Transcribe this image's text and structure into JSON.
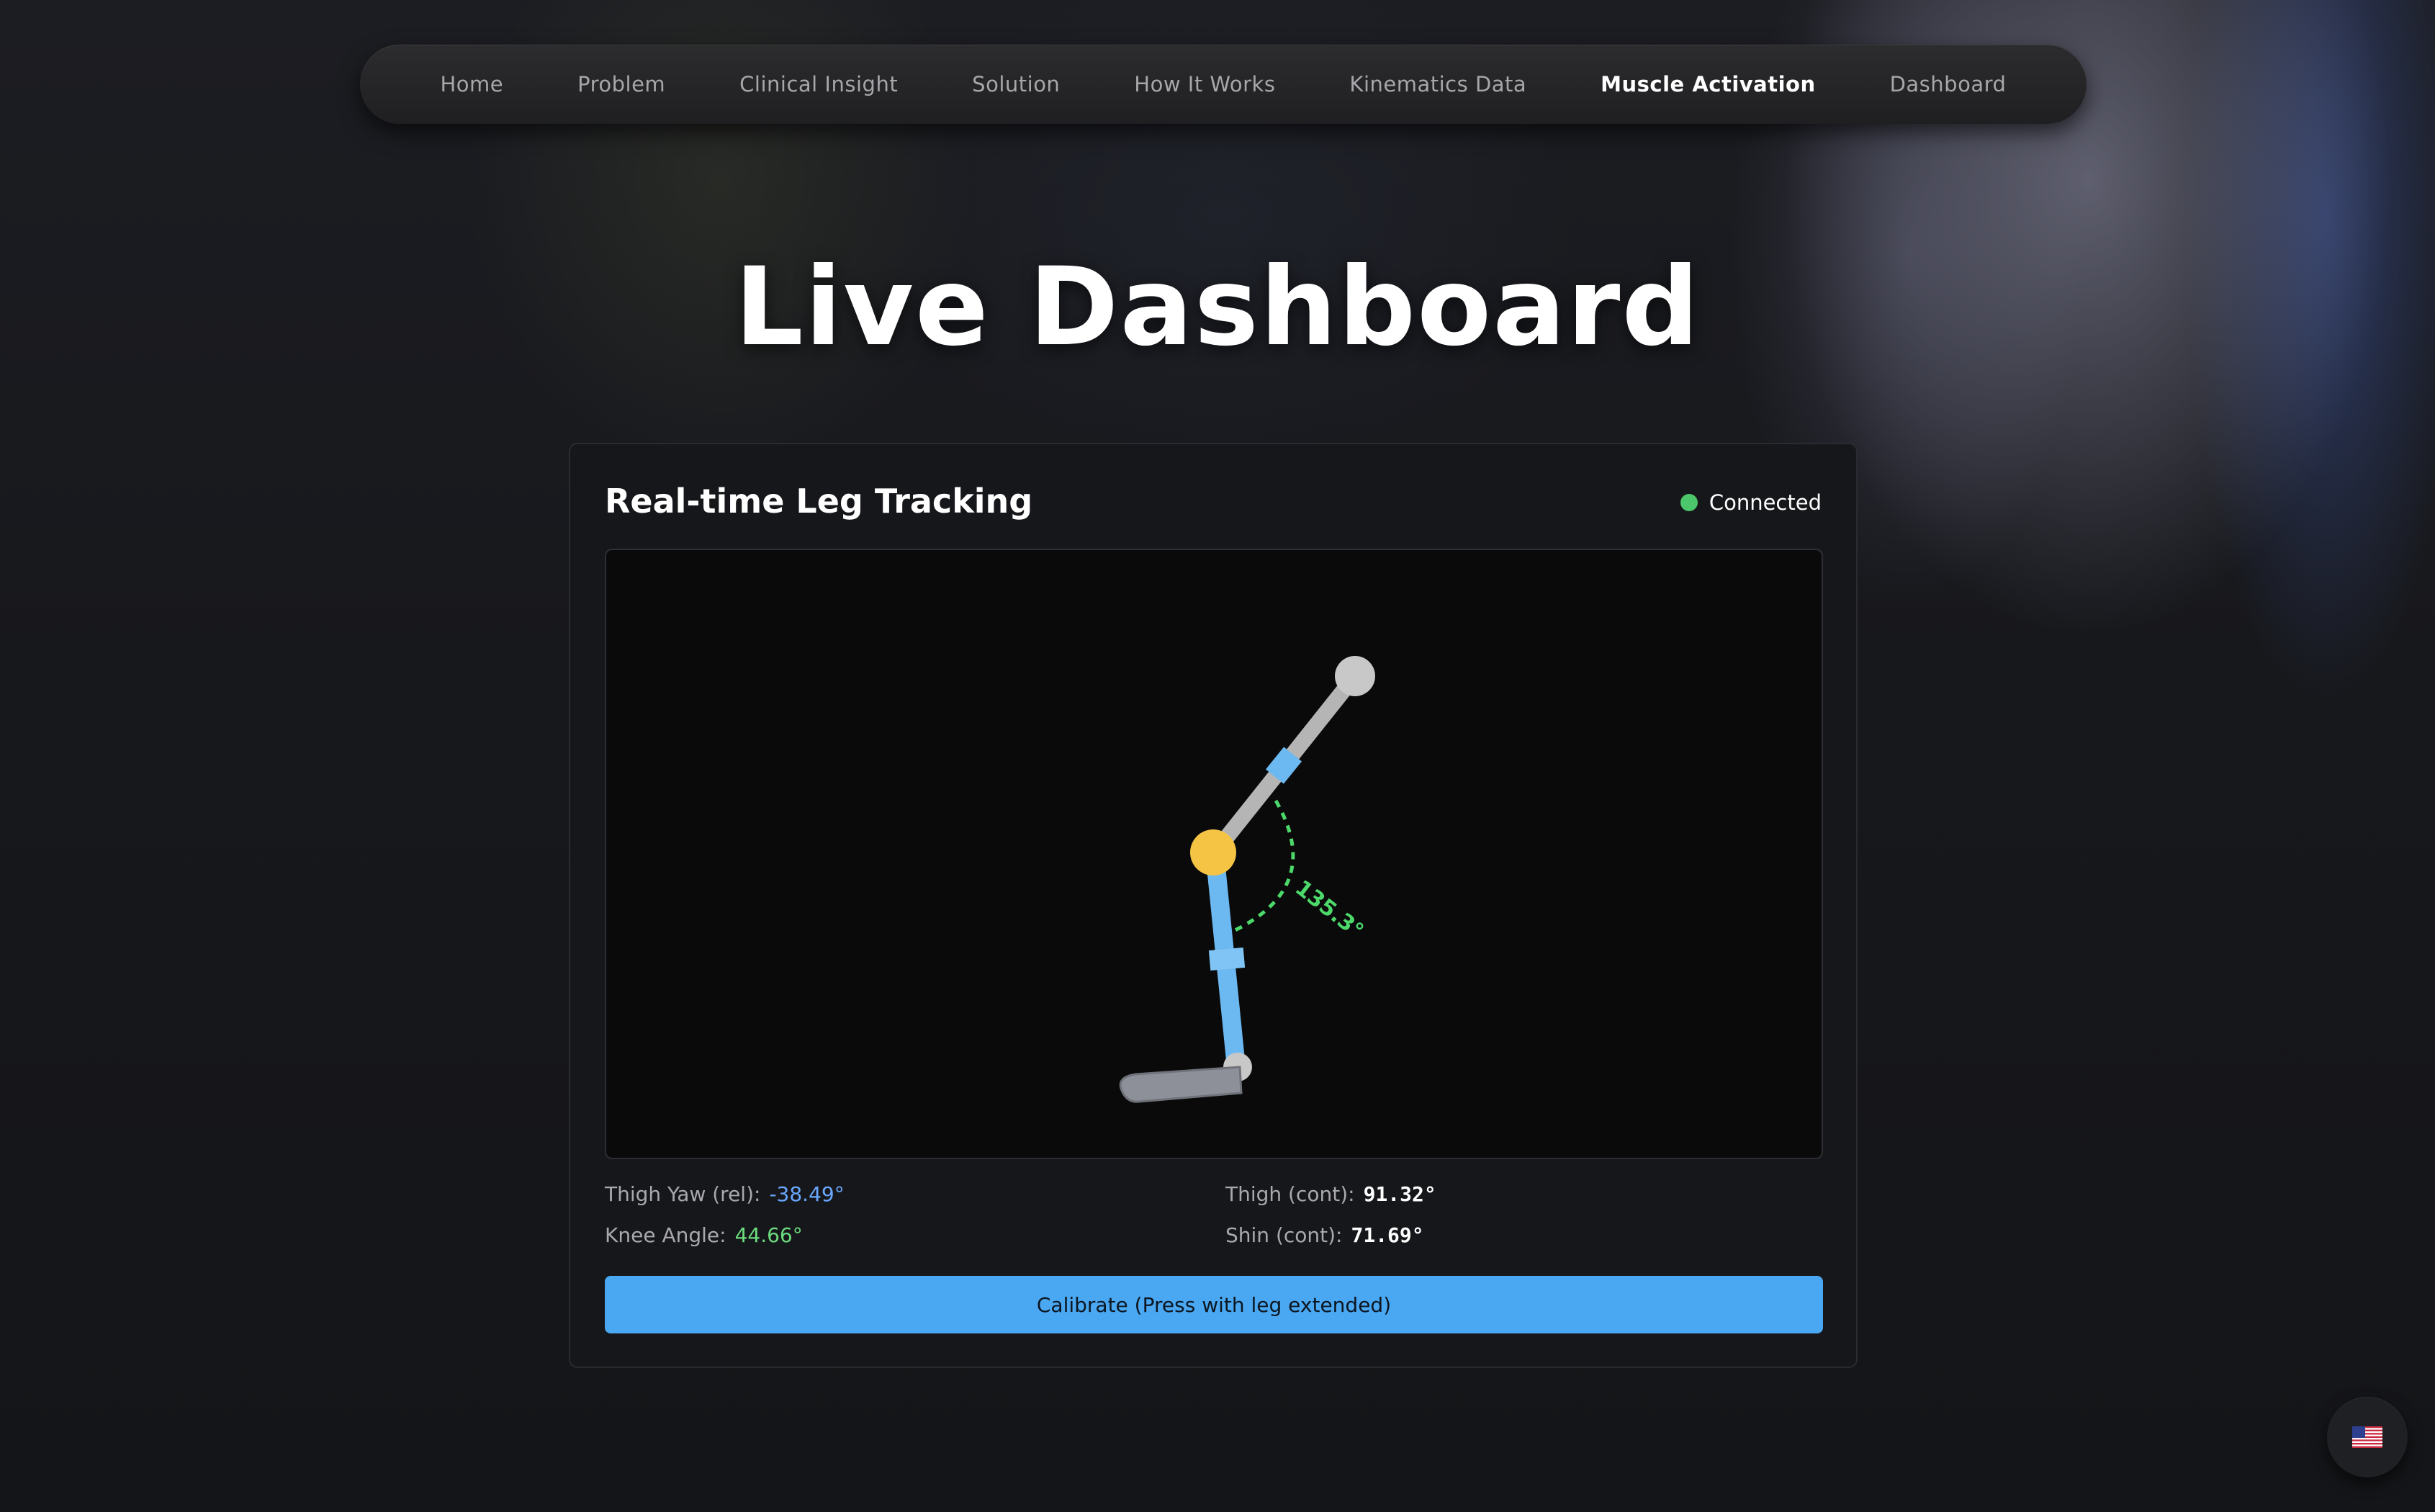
{
  "nav": {
    "items": [
      {
        "label": "Home"
      },
      {
        "label": "Problem"
      },
      {
        "label": "Clinical Insight"
      },
      {
        "label": "Solution"
      },
      {
        "label": "How It Works"
      },
      {
        "label": "Kinematics Data"
      },
      {
        "label": "Muscle Activation",
        "active": true
      },
      {
        "label": "Dashboard"
      }
    ]
  },
  "page": {
    "title": "Live Dashboard"
  },
  "card": {
    "title": "Real-time Leg Tracking",
    "status": "Connected",
    "status_color": "#4cc66a",
    "angle_label": "135.3°",
    "readings": {
      "thigh_yaw": {
        "label": "Thigh Yaw (rel):",
        "value": "-38.49°"
      },
      "knee_angle": {
        "label": "Knee Angle:",
        "value": "44.66°"
      },
      "thigh_cont": {
        "label": "Thigh (cont):",
        "value": "91.32°"
      },
      "shin_cont": {
        "label": "Shin (cont):",
        "value": "71.69°"
      }
    },
    "calibrate_label": "Calibrate (Press with leg extended)"
  },
  "colors": {
    "accent": "#4aa7f2",
    "knee_joint": "#f6c445",
    "shin": "#6cb8f0",
    "thigh": "#b5b5b5",
    "angle_arc": "#4cd96a"
  },
  "icons": {
    "language": "us-flag-icon"
  }
}
